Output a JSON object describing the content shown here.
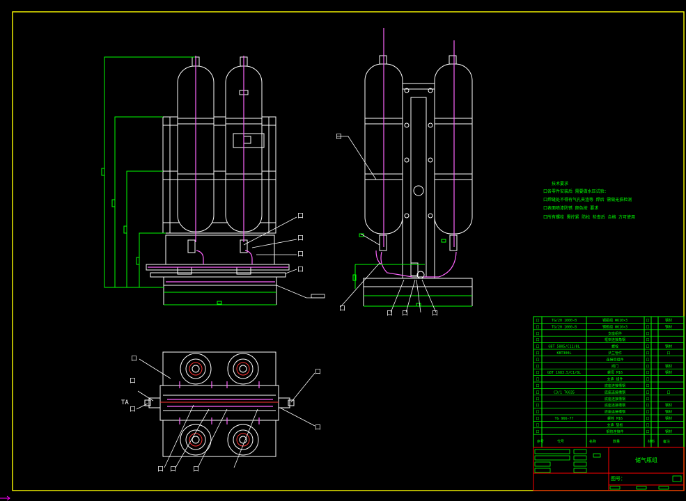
{
  "colors": {
    "background": "#000000",
    "frame": "#ffff00",
    "outline": "#ffffff",
    "dimension": "#00ff00",
    "centerline": "#ff00ff",
    "pipe": "#ff66ff",
    "titleblock_line": "#ff0000",
    "cursor": "#ff00ff"
  },
  "front_view": {
    "balloons": [
      "口",
      "口",
      "口",
      "口"
    ]
  },
  "side_view": {
    "balloons": [
      "口",
      "口",
      "口",
      "口",
      "口"
    ]
  },
  "top_view": {
    "side_label": "TA",
    "balloons": [
      "口",
      "口",
      "口",
      "口",
      "口",
      "口",
      "口",
      "口"
    ]
  },
  "notes": {
    "title": "技术要求",
    "lines": [
      "口各零件安装后 需要做水压试验：",
      "口焊缝处不得有气孔夹渣等 焊后 需做无损检测",
      "口表面喷漆防锈 颜色按 要求",
      "口所有螺栓 需拧紧 防松 检查后 合格 方可使用"
    ]
  },
  "bom": {
    "rows": [
      [
        "口",
        "TG/20 1000-B",
        "钢瓶组 Φ610×3",
        "口",
        "钢材"
      ],
      [
        "口",
        "TG/20 1000-B",
        "钢瓶组 Φ610×3",
        "口",
        "钢材"
      ],
      [
        "口",
        "",
        "支座组件",
        "口",
        ""
      ],
      [
        "口",
        "",
        "框架连接角钢",
        "口",
        ""
      ],
      [
        "口",
        "GBT 5805/C11/8L",
        "螺栓",
        "口",
        "钢材"
      ],
      [
        "口",
        "KBT300L",
        "法兰管件",
        "口",
        "口"
      ],
      [
        "口",
        "",
        "连接管组件",
        "口",
        ""
      ],
      [
        "口",
        "",
        "阀门",
        "口",
        "钢材"
      ],
      [
        "口",
        "GBT 1683.5/C1/8L",
        "螺母 M16",
        "口",
        "钢材"
      ],
      [
        "口",
        "",
        "支承 组件",
        "口",
        ""
      ],
      [
        "口",
        "",
        "底座连接槽钢",
        "口",
        ""
      ],
      [
        "口",
        "C3/1 TG035",
        "底座连接槽钢",
        "口",
        "口"
      ],
      [
        "口",
        "",
        "底座连接槽钢",
        "口",
        ""
      ],
      [
        "口",
        "",
        "底座连接槽钢",
        "口",
        "钢材"
      ],
      [
        "口",
        "",
        "底座连接槽钢",
        "口",
        "钢材"
      ],
      [
        "口",
        "TG 966-77",
        "螺栓 M16",
        "口",
        "钢材"
      ],
      [
        "口",
        "",
        "支承 垫板",
        "口",
        ""
      ],
      [
        "口",
        "",
        "钢管连接件",
        "口",
        "钢材"
      ]
    ],
    "header": [
      "序号",
      "代号",
      "名称",
      "数量",
      "材料",
      "备注"
    ]
  },
  "title_block": {
    "drawing_name": "储气瓶组",
    "drawing_no_label": "图号："
  }
}
